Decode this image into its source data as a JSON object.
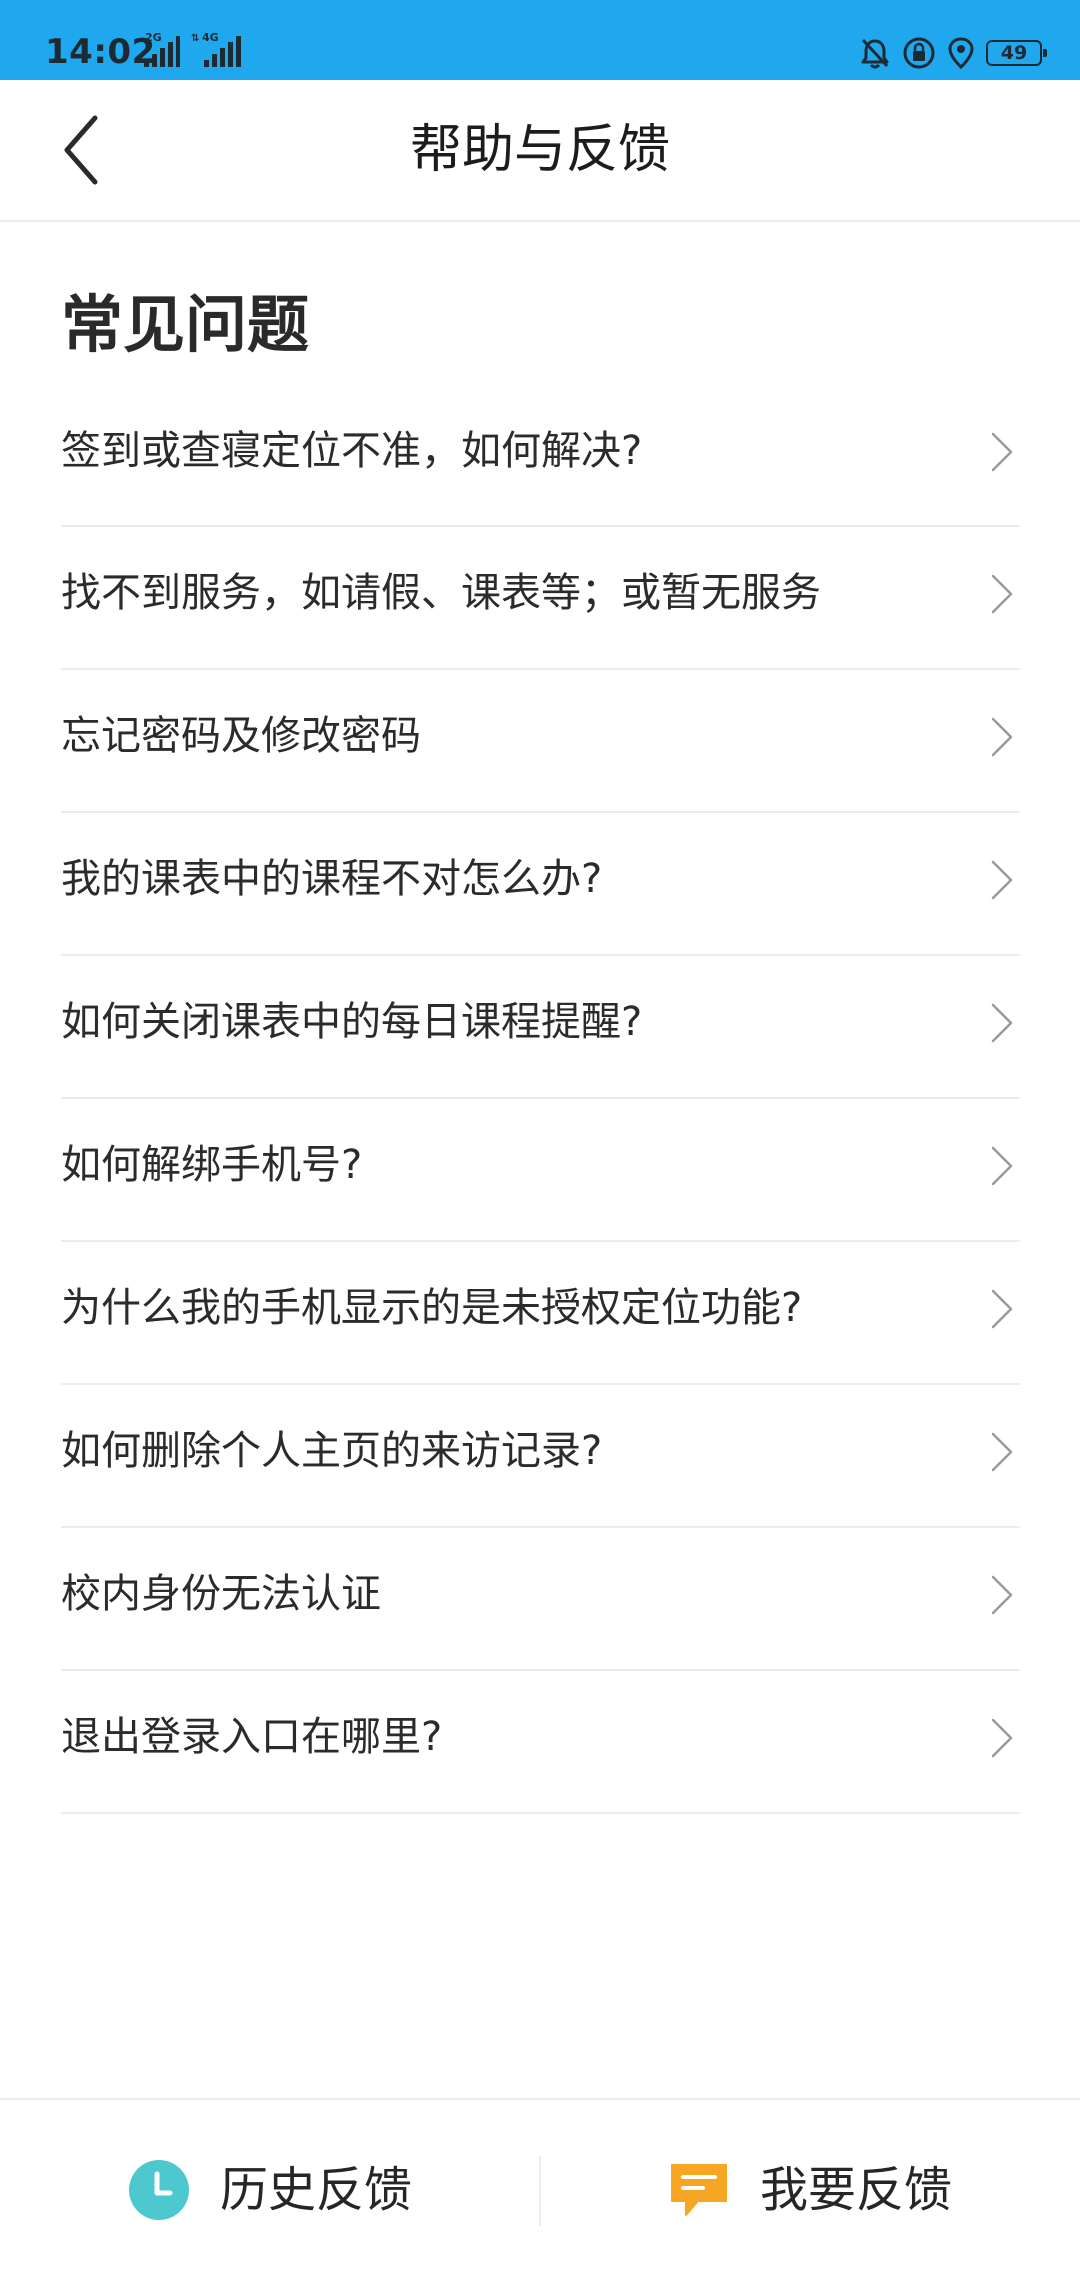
{
  "status_bar": {
    "time": "14:02",
    "network_2g": "2G",
    "network_4g": "4G",
    "battery_level": "49",
    "background_color": "#1fa8ee",
    "icons": [
      "signal-icon",
      "signal-icon",
      "alarm-off-icon",
      "rotation-lock-icon",
      "location-icon",
      "battery-icon"
    ]
  },
  "header": {
    "title": "帮助与反馈",
    "back_icon": "chevron-left-icon"
  },
  "faq": {
    "section_title": "常见问题",
    "items": [
      {
        "label": "签到或查寝定位不准，如何解决?"
      },
      {
        "label": "找不到服务，如请假、课表等；或暂无服务"
      },
      {
        "label": "忘记密码及修改密码"
      },
      {
        "label": "我的课表中的课程不对怎么办?"
      },
      {
        "label": "如何关闭课表中的每日课程提醒?"
      },
      {
        "label": "如何解绑手机号?"
      },
      {
        "label": "为什么我的手机显示的是未授权定位功能?"
      },
      {
        "label": "如何删除个人主页的来访记录?"
      },
      {
        "label": "校内身份无法认证"
      },
      {
        "label": "退出登录入口在哪里?"
      }
    ]
  },
  "bottom_bar": {
    "history_label": "历史反馈",
    "history_icon": "clock-icon",
    "history_icon_color": "#4ec8cf",
    "feedback_label": "我要反馈",
    "feedback_icon": "chat-bubble-icon",
    "feedback_icon_color": "#f6a623"
  }
}
